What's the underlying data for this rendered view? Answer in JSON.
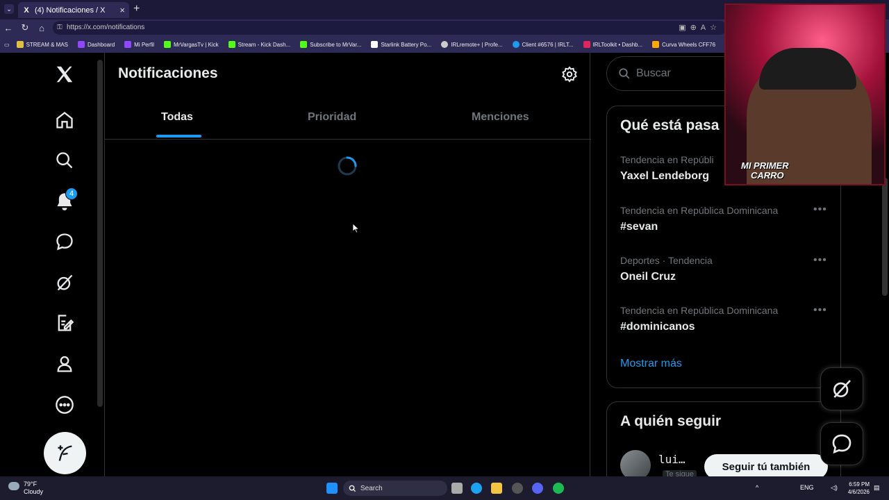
{
  "browser": {
    "tab_title": "(4) Notificaciones / X",
    "tab_favicon": "X",
    "url": "https://x.com/notifications",
    "bookmarks": [
      {
        "label": "STREAM & MAS",
        "color": "#e0c040"
      },
      {
        "label": "Dashboard",
        "color": "#9146ff"
      },
      {
        "label": "Mi Perfil",
        "color": "#9146ff"
      },
      {
        "label": "MrVargasTv | Kick",
        "color": "#53fc18"
      },
      {
        "label": "Stream - Kick Dash...",
        "color": "#53fc18"
      },
      {
        "label": "Subscribe to MrVar...",
        "color": "#53fc18"
      },
      {
        "label": "Starlink Battery Po...",
        "color": "#ffffff"
      },
      {
        "label": "IRLremote+ | Profe...",
        "color": "#cccccc"
      },
      {
        "label": "Client #6576 | IRLT...",
        "color": "#1d9bf0"
      },
      {
        "label": "IRLToolkit • Dashb...",
        "color": "#e0245e"
      },
      {
        "label": "Curva Wheels CFF76",
        "color": "#ffaa00"
      }
    ]
  },
  "nav": {
    "notifications_badge": "4",
    "icons": [
      "x-logo-icon",
      "home-icon",
      "search-icon",
      "bell-icon",
      "messages-icon",
      "grok-icon",
      "drafts-icon",
      "profile-icon",
      "more-icon"
    ]
  },
  "main": {
    "title": "Notificaciones",
    "tabs": [
      {
        "label": "Todas",
        "active": true
      },
      {
        "label": "Prioridad",
        "active": false
      },
      {
        "label": "Menciones",
        "active": false
      }
    ]
  },
  "sidebar": {
    "search_placeholder": "Buscar",
    "trends_title": "Qué está pasa",
    "trends": [
      {
        "meta": "Tendencia en Repúbli",
        "name": "Yaxel Lendeborg"
      },
      {
        "meta": "Tendencia en República Dominicana",
        "name": "#sevan"
      },
      {
        "meta": "Deportes · Tendencia",
        "name": "Oneil Cruz"
      },
      {
        "meta": "Tendencia en República Dominicana",
        "name": "#dominicanos"
      }
    ],
    "show_more": "Mostrar más",
    "follow_title": "A quién seguir",
    "suggested_user": "lui…",
    "suggested_sub": "Te sigue",
    "follow_button": "Seguir tú también"
  },
  "webcam": {
    "label_line1": "MI PRIMER",
    "label_line2": "CARRO"
  },
  "taskbar": {
    "weather_temp": "79°F",
    "weather_desc": "Cloudy",
    "search_label": "Search",
    "lang": "ENG",
    "time": "6:59 PM",
    "date": "4/6/2026"
  },
  "colors": {
    "accent": "#1d9bf0",
    "background": "#000000",
    "muted_text": "#71767b"
  }
}
